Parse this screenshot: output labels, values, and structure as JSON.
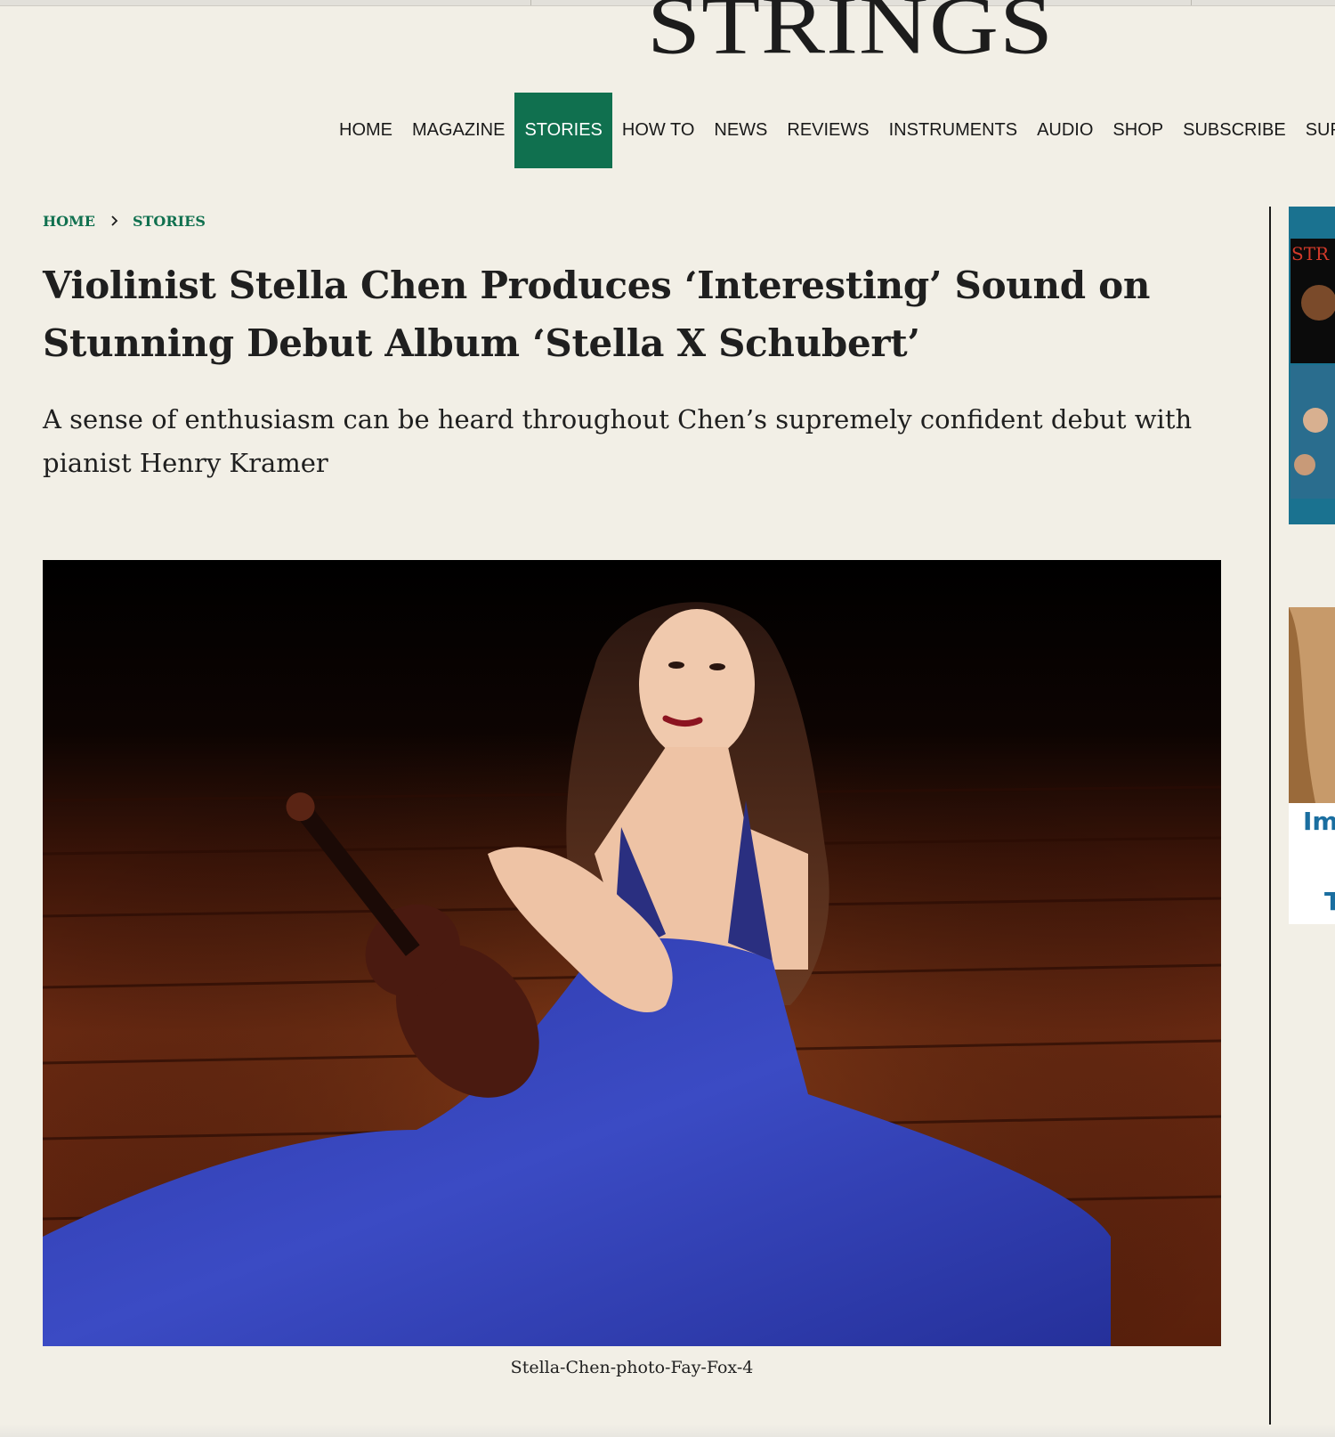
{
  "site": {
    "logo": "STRINGS"
  },
  "nav": {
    "items": [
      {
        "label": "HOME"
      },
      {
        "label": "MAGAZINE"
      },
      {
        "label": "STORIES",
        "active": true
      },
      {
        "label": "HOW TO"
      },
      {
        "label": "NEWS"
      },
      {
        "label": "REVIEWS"
      },
      {
        "label": "INSTRUMENTS"
      },
      {
        "label": "AUDIO"
      },
      {
        "label": "SHOP"
      },
      {
        "label": "SUBSCRIBE"
      },
      {
        "label": "SUP"
      }
    ]
  },
  "breadcrumb": {
    "home": "HOME",
    "section": "STORIES"
  },
  "article": {
    "title": "Violinist Stella Chen Produces ‘Interesting’ Sound on Stunning Debut Album ‘Stella X Schubert’",
    "subtitle": "A sense of enthusiasm can be heard throughout Chen’s supremely confident debut with pianist Henry Kramer",
    "image_caption": "Stella-Chen-photo-Fay-Fox-4"
  },
  "sidebar": {
    "ad1_text": "STR",
    "ad2_text_1": "Im",
    "ad2_text_2": "T"
  },
  "colors": {
    "accent": "#10704f",
    "background": "#f2efe6",
    "text": "#1f1f1f",
    "dress": "#3341b8",
    "floor": "#6a2a12"
  }
}
